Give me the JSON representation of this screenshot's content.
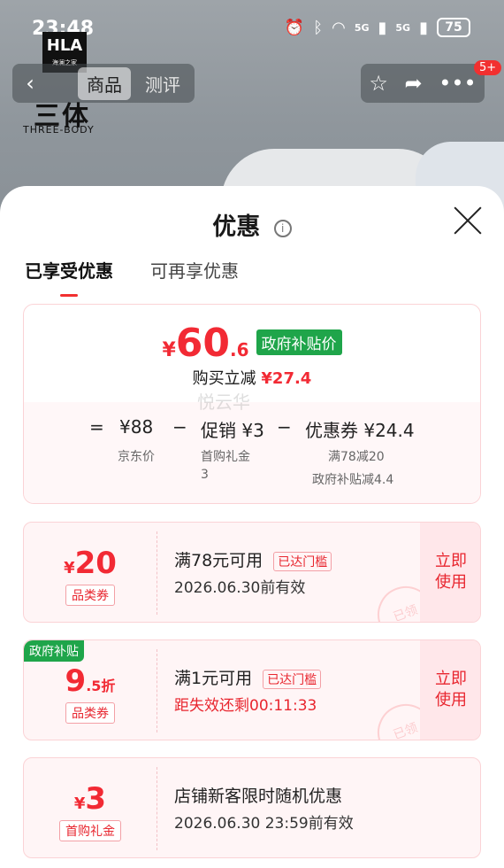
{
  "status_bar": {
    "time": "23:48",
    "battery": "75",
    "signal1": "5G",
    "signal2": "5G"
  },
  "background": {
    "logo_top": "HLA",
    "logo_sub": "海澜之家",
    "logo_cn": "三体",
    "logo_en": "THREE-BODY",
    "tab_goods": "商品",
    "tab_review": "测评",
    "badge": "5+"
  },
  "sheet": {
    "title": "优惠",
    "info_symbol": "i",
    "tabs": {
      "active": "已享受优惠",
      "inactive": "可再享优惠"
    }
  },
  "summary": {
    "currency": "¥",
    "price_int": "60",
    "price_dec": ".6",
    "gov_price_tag": "政府补贴价",
    "reduce_label": "购买立减",
    "reduce_amount": "¥27.4",
    "eq": "=",
    "base_price": "¥88",
    "minus1": "−",
    "promo": "促销 ¥3",
    "minus2": "−",
    "coupon": "优惠券 ¥24.4",
    "base_label": "京东价",
    "promo_sub1": "首购礼金",
    "promo_sub2": "3",
    "coupon_sub1": "满78减20",
    "coupon_sub2": "政府补贴减4.4",
    "watermark": "悦云华"
  },
  "coupons": [
    {
      "currency": "¥",
      "value": "20",
      "suffix": "",
      "category": "品类券",
      "condition": "满78元可用",
      "reached": "已达门槛",
      "validity": "2026.06.30前有效",
      "action1": "立即",
      "action2": "使用",
      "stamp": "已领"
    },
    {
      "corner": "政府补贴",
      "currency": "",
      "value": "9",
      "suffix": ".5折",
      "category": "品类券",
      "condition": "满1元可用",
      "reached": "已达门槛",
      "validity": "距失效还剩00:11:33",
      "action1": "立即",
      "action2": "使用",
      "stamp": "已领"
    },
    {
      "currency": "¥",
      "value": "3",
      "suffix": "",
      "category": "首购礼金",
      "condition": "店铺新客限时随机优惠",
      "validity": "2026.06.30 23:59前有效"
    }
  ],
  "colors": {
    "accent_red": "#f22a34",
    "gov_green": "#1fa54a"
  }
}
